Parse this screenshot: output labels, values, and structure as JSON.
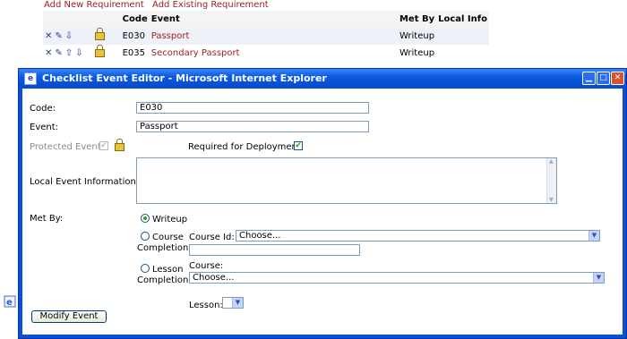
{
  "background": {
    "links": [
      "Add New Requirement",
      "Add Existing Requirement"
    ],
    "table": {
      "headers": {
        "code": "Code",
        "event": "Event",
        "met_by": "Met By",
        "local_info": "Local Info"
      },
      "rows": [
        {
          "code": "E030",
          "event": "Passport",
          "met_by": "Writeup"
        },
        {
          "code": "E035",
          "event": "Secondary Passport",
          "met_by": "Writeup"
        }
      ]
    }
  },
  "dialog": {
    "title": "Checklist Event Editor - Microsoft Internet Explorer",
    "fields": {
      "code_label": "Code:",
      "code_value": "E030",
      "event_label": "Event:",
      "event_value": "Passport",
      "protected_label": "Protected Event",
      "required_label": "Required for Deployment",
      "local_info_label": "Local Event Information:",
      "met_by_label": "Met By:"
    },
    "met_by_options": {
      "writeup": "Writeup",
      "course_line1": "Course",
      "course_line2": "Completion",
      "lesson_line1": "Lesson",
      "lesson_line2": "Completion"
    },
    "course_id_label": "Course Id:",
    "course_id_value": "Choose...",
    "course_label": "Course:",
    "course_value": "Choose...",
    "lesson_label": "Lesson:",
    "modify_button": "Modify Event"
  }
}
